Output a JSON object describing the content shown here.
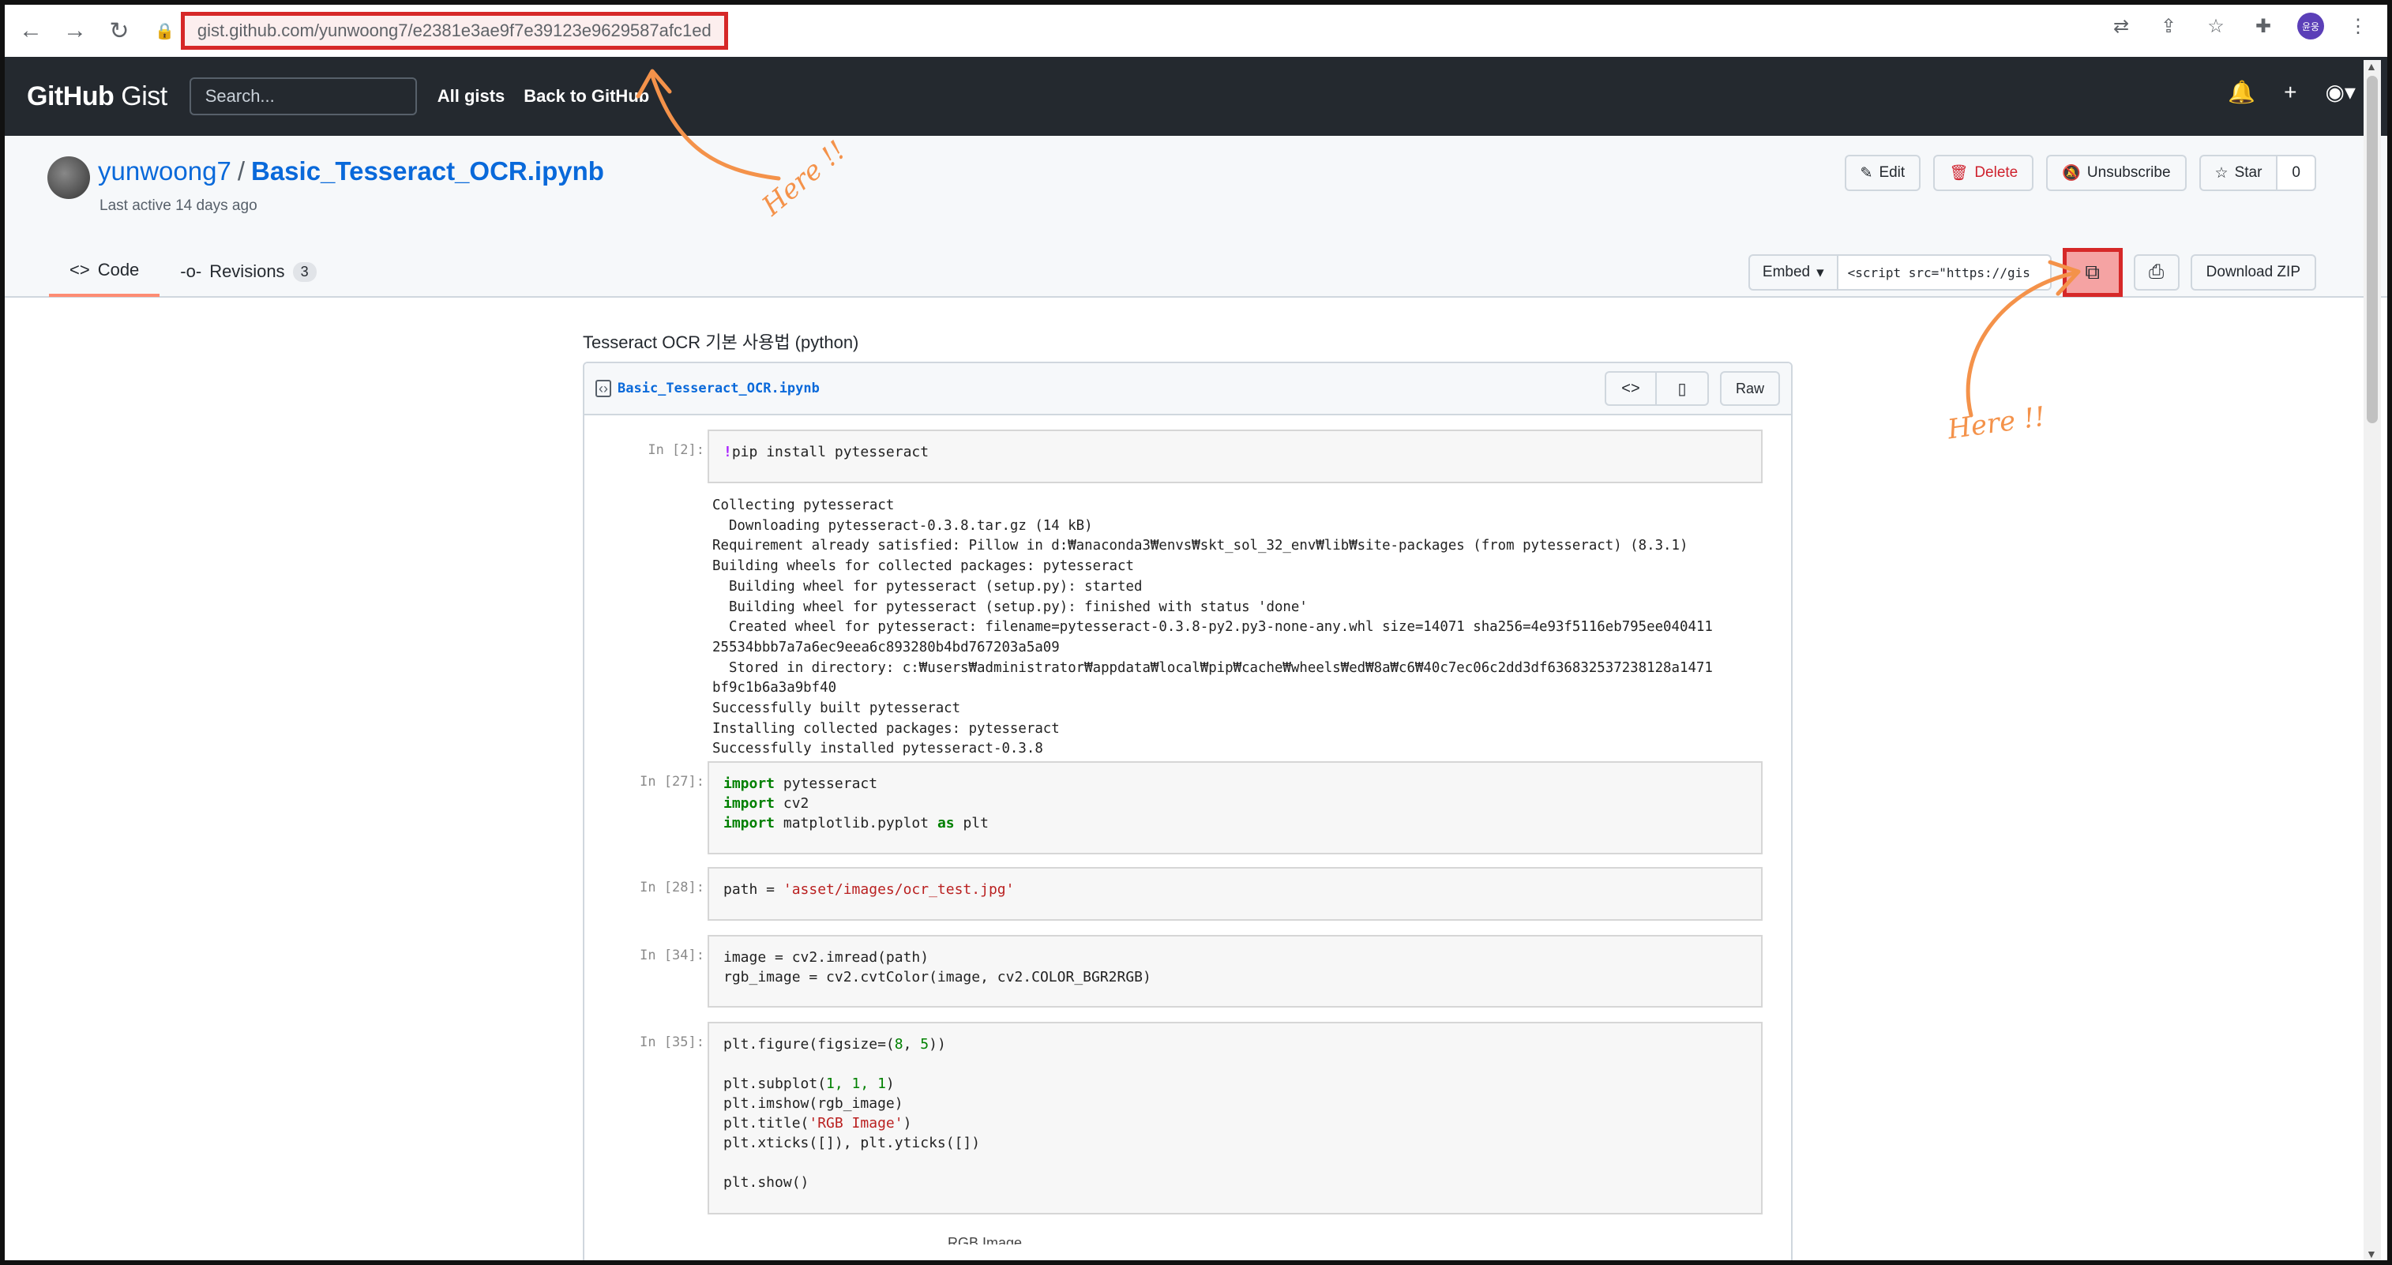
{
  "browser": {
    "url_host": "gist.github.com",
    "url_path": "/yunwoong7/e2381e3ae9f7e39123e9629587afc1ed",
    "profile_initials": "윤웅"
  },
  "header": {
    "logo_bold": "GitHub",
    "logo_light": "Gist",
    "search_placeholder": "Search...",
    "link_all_gists": "All gists",
    "link_back": "Back to GitHub"
  },
  "repo": {
    "owner": "yunwoong7",
    "separator": "/",
    "name": "Basic_Tesseract_OCR.ipynb",
    "last_active": "Last active 14 days ago",
    "edit_label": "Edit",
    "delete_label": "Delete",
    "unsubscribe_label": "Unsubscribe",
    "star_label": "Star",
    "star_count": "0"
  },
  "tabs": {
    "code": "Code",
    "revisions": "Revisions",
    "revisions_count": "3"
  },
  "embed": {
    "select_label": "Embed",
    "input_value": "<script src=\"https://gis",
    "download_zip": "Download ZIP"
  },
  "gist": {
    "description": "Tesseract OCR 기본 사용법 (python)",
    "filename": "Basic_Tesseract_OCR.ipynb",
    "raw_label": "Raw"
  },
  "cells": {
    "c1_prompt": "In [2]:",
    "c1_code_magic": "!",
    "c1_code_rest": "pip install pytesseract",
    "c1_output": "Collecting pytesseract\n  Downloading pytesseract-0.3.8.tar.gz (14 kB)\nRequirement already satisfied: Pillow in d:₩anaconda3₩envs₩skt_sol_32_env₩lib₩site-packages (from pytesseract) (8.3.1)\nBuilding wheels for collected packages: pytesseract\n  Building wheel for pytesseract (setup.py): started\n  Building wheel for pytesseract (setup.py): finished with status 'done'\n  Created wheel for pytesseract: filename=pytesseract-0.3.8-py2.py3-none-any.whl size=14071 sha256=4e93f5116eb795ee040411\n25534bbb7a7a6ec9eea6c893280b4bd767203a5a09\n  Stored in directory: c:₩users₩administrator₩appdata₩local₩pip₩cache₩wheels₩ed₩8a₩c6₩40c7ec06c2dd3df636832537238128a1471\nbf9c1b6a3a9bf40\nSuccessfully built pytesseract\nInstalling collected packages: pytesseract\nSuccessfully installed pytesseract-0.3.8",
    "c2_prompt": "In [27]:",
    "c2_l1_kw": "import",
    "c2_l1_rest": " pytesseract",
    "c2_l2_kw": "import",
    "c2_l2_rest": " cv2",
    "c2_l3_kw": "import",
    "c2_l3_mid": " matplotlib.pyplot ",
    "c2_l3_kw2": "as",
    "c2_l3_rest": " plt",
    "c3_prompt": "In [28]:",
    "c3_pre": "path = ",
    "c3_str": "'asset/images/ocr_test.jpg'",
    "c4_prompt": "In [34]:",
    "c4_l1": "image = cv2.imread(path)",
    "c4_l2": "rgb_image = cv2.cvtColor(image, cv2.COLOR_BGR2RGB)",
    "c5_prompt": "In [35]:",
    "c5_l1_pre": "plt.figure(figsize=(",
    "c5_l1_n1": "8",
    "c5_l1_mid": ", ",
    "c5_l1_n2": "5",
    "c5_l1_post": "))",
    "c5_l2_pre": "plt.subplot(",
    "c5_l2_n": "1, 1, 1",
    "c5_l2_post": ")",
    "c5_l3": "plt.imshow(rgb_image)",
    "c5_l4_pre": "plt.title(",
    "c5_l4_str": "'RGB Image'",
    "c5_l4_post": ")",
    "c5_l5": "plt.xticks([]), plt.yticks([])",
    "c5_l6": "plt.show()",
    "figure_title_partial": "RGB Image"
  },
  "annotations": {
    "here1": "Here !!",
    "here2": "Here !!",
    "color": "#f4924a",
    "highlight": "#d62828"
  }
}
